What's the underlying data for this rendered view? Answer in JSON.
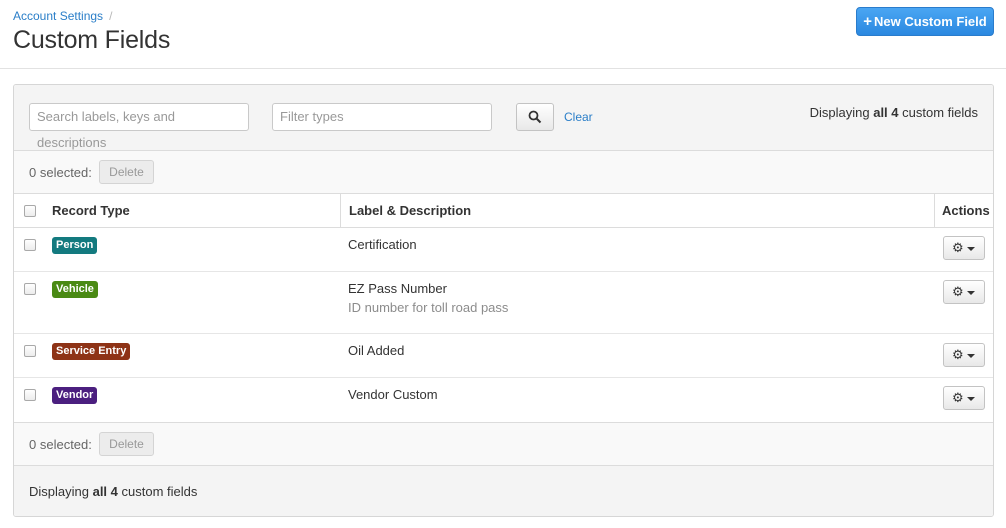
{
  "breadcrumb": {
    "parent": "Account Settings",
    "separator": "/"
  },
  "page_title": "Custom Fields",
  "new_button": {
    "icon": "plus-icon",
    "label": "New Custom Field"
  },
  "filters": {
    "search_placeholder": "Search labels, keys and descriptions",
    "types_placeholder": "Filter types",
    "search_icon": "search-icon",
    "clear_label": "Clear",
    "displaying": {
      "prefix": "Displaying ",
      "strong": "all 4",
      "suffix": " custom fields"
    }
  },
  "bulk": {
    "selected_label": "0 selected:",
    "delete_label": "Delete"
  },
  "table": {
    "columns": {
      "record_type": "Record Type",
      "label_description": "Label & Description",
      "actions": "Actions"
    },
    "rows": [
      {
        "type": "Person",
        "type_color": "#137a7f",
        "label": "Certification",
        "description": ""
      },
      {
        "type": "Vehicle",
        "type_color": "#4a8a14",
        "label": "EZ Pass Number",
        "description": "ID number for toll road pass"
      },
      {
        "type": "Service Entry",
        "type_color": "#8e3316",
        "label": "Oil Added",
        "description": ""
      },
      {
        "type": "Vendor",
        "type_color": "#4b1f7f",
        "label": "Vendor Custom",
        "description": ""
      }
    ],
    "action_icon": "gear-icon"
  },
  "footer": {
    "prefix": "Displaying ",
    "strong": "all 4",
    "suffix": " custom fields"
  },
  "colors": {
    "accent": "#2a7ec8",
    "primary_button": "#3b97ea"
  }
}
